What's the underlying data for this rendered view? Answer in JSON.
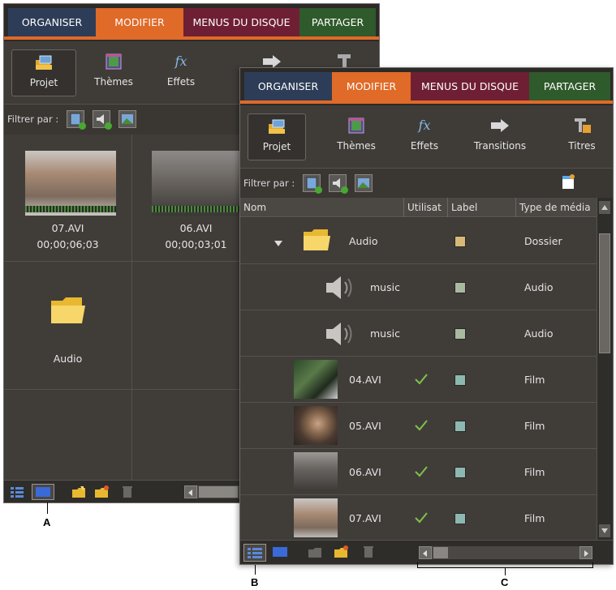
{
  "tabs": {
    "organiser": "ORGANISER",
    "modifier": "MODIFIER",
    "menus": "MENUS DU DISQUE",
    "partager": "PARTAGER"
  },
  "tools": {
    "projet": "Projet",
    "themes": "Thèmes",
    "effets": "Effets",
    "transitions": "Transitions",
    "titres": "Titres",
    "fx_glyph": "fx"
  },
  "filter": {
    "label": "Filtrer par :"
  },
  "back_grid": [
    {
      "name": "07.AVI",
      "duration": "00;00;06;03"
    },
    {
      "name": "06.AVI",
      "duration": "00;00;03;01"
    },
    {
      "name": "Audio"
    }
  ],
  "columns": {
    "nom": "Nom",
    "utilisation": "Utilisat",
    "label": "Label",
    "type": "Type de média"
  },
  "rows": [
    {
      "name": "Audio",
      "label_color": "#d6b978",
      "type": "Dossier",
      "used": false,
      "kind": "folder"
    },
    {
      "name": "music",
      "label_color": "#a9b9a0",
      "type": "Audio",
      "used": false,
      "kind": "audio"
    },
    {
      "name": "music",
      "label_color": "#a9b9a0",
      "type": "Audio",
      "used": false,
      "kind": "audio"
    },
    {
      "name": "04.AVI",
      "label_color": "#8cb8b0",
      "type": "Film",
      "used": true,
      "kind": "film"
    },
    {
      "name": "05.AVI",
      "label_color": "#8cb8b0",
      "type": "Film",
      "used": true,
      "kind": "film"
    },
    {
      "name": "06.AVI",
      "label_color": "#8cb8b0",
      "type": "Film",
      "used": true,
      "kind": "film"
    },
    {
      "name": "07.AVI",
      "label_color": "#8cb8b0",
      "type": "Film",
      "used": true,
      "kind": "film"
    }
  ],
  "callouts": {
    "a": "A",
    "b": "B",
    "c": "C"
  },
  "colors": {
    "accent": "#e06a28",
    "check": "#7fc24a"
  }
}
